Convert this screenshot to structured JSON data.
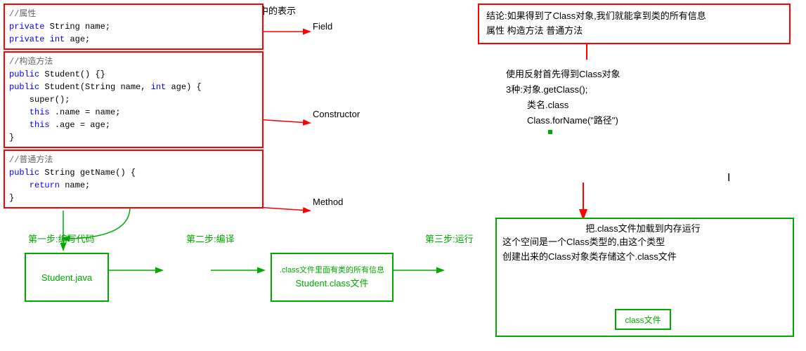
{
  "top_label": "在反射中的表示",
  "labels": {
    "field": "Field",
    "constructor": "Constructor",
    "method": "Method"
  },
  "conclusion": {
    "line1": "结论:如果得到了Class对象,我们就能拿到类的所有信息",
    "line2": "属性  构造方法 普通方法"
  },
  "reflection_steps": {
    "title": "使用反射首先得到Class对象",
    "step1": "3种:对象.getClass();",
    "step2": "类名.class",
    "step3": "Class.forName(\"路径\")"
  },
  "code": {
    "properties_comment": "//属性",
    "line1": "private String name;",
    "line2": "private int age;",
    "constructor_comment": "//构造方法",
    "c1": "public Student() {}",
    "c2": "public Student(String name, int age) {",
    "c3": "    super();",
    "c4": "    this.name = name;",
    "c5": "    this.age = age;",
    "c6": "}",
    "method_comment": "//普通方法",
    "m1": "public String getName() {",
    "m2": "    return name;",
    "m3": "}"
  },
  "bottom": {
    "step1_label": "第一步:编写代码",
    "step2_label": "第二步:编译",
    "step3_label": "第三步:运行",
    "java_file": "Student.java",
    "class_file_content": ".class文件里面有类的所有信息",
    "class_file_name": "Student.class文件",
    "memory_label": "把.class文件加载到内存运行",
    "memory_content1": "这个空间是一个Class类型的,由这个类型",
    "memory_content2": "创建出来的Class对象类存储这个.class文件",
    "class_file_label": "class文件"
  }
}
